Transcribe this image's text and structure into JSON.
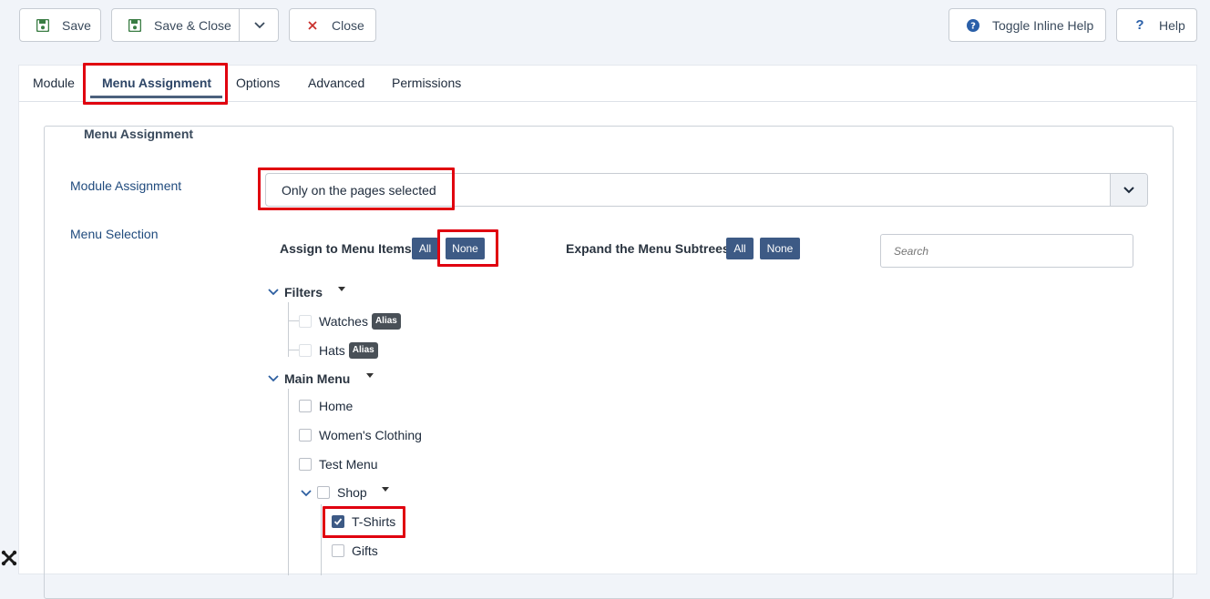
{
  "toolbar": {
    "save_label": "Save",
    "save_close_label": "Save & Close",
    "close_label": "Close",
    "toggle_help_label": "Toggle Inline Help",
    "help_label": "Help"
  },
  "tabs": [
    {
      "label": "Module"
    },
    {
      "label": "Menu Assignment",
      "active": true
    },
    {
      "label": "Options"
    },
    {
      "label": "Advanced"
    },
    {
      "label": "Permissions"
    }
  ],
  "fieldset": {
    "legend": "Menu Assignment",
    "module_assignment_label": "Module Assignment",
    "module_assignment_value": "Only on the pages selected",
    "menu_selection_label": "Menu Selection"
  },
  "controls": {
    "assign_title": "Assign to Menu Items",
    "assign_all": "All",
    "assign_none": "None",
    "expand_title": "Expand the Menu Subtrees",
    "expand_all": "All",
    "expand_none": "None",
    "search_placeholder": "Search"
  },
  "tree": {
    "filters": {
      "label": "Filters",
      "items": [
        {
          "label": "Watches",
          "badge": "Alias"
        },
        {
          "label": "Hats",
          "badge": "Alias"
        }
      ]
    },
    "main_menu": {
      "label": "Main Menu",
      "items": [
        {
          "label": "Home"
        },
        {
          "label": "Women's Clothing"
        },
        {
          "label": "Test Menu"
        },
        {
          "label": "Shop"
        }
      ],
      "shop_children": [
        {
          "label": "T-Shirts",
          "checked": true
        },
        {
          "label": "Gifts",
          "checked": false
        }
      ]
    }
  },
  "colors": {
    "accent": "#3d5a85",
    "highlight": "#e0000f",
    "save_icon": "#3a7d44",
    "close_icon": "#c9302c",
    "help_icon": "#2a5fa8"
  }
}
